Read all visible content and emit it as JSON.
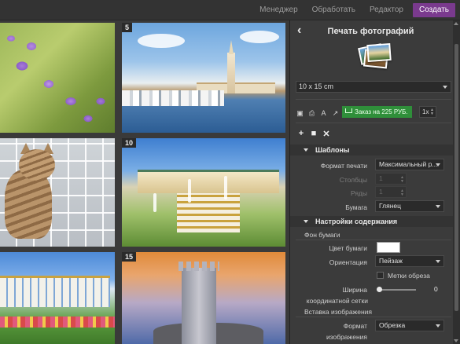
{
  "topnav": {
    "items": [
      "Менеджер",
      "Обработать",
      "Редактор"
    ],
    "create": "Создать"
  },
  "grid": {
    "numbers": [
      "5",
      "10",
      "15"
    ]
  },
  "panel": {
    "title": "Печать фотографий",
    "size": "10 x 15 cm",
    "order_label": "Заказ на 225 РУБ.",
    "quantity": "1x",
    "templates_header": "Шаблоны",
    "print_format_label": "Формат печати",
    "print_format_value": "Максимальный р...",
    "columns_label": "Столбцы",
    "columns_value": "1",
    "rows_label": "Ряды",
    "rows_value": "1",
    "paper_label": "Бумага",
    "paper_value": "Глянец",
    "content_header": "Настройки содержания",
    "paper_bg_group": "Фон бумаги",
    "paper_color_label": "Цвет бумаги",
    "paper_color": "#ffffff",
    "orientation_label": "Ориентация",
    "orientation_value": "Пейзаж",
    "crop_marks_label": "Метки обреза",
    "grid_width_label_1": "Ширина",
    "grid_width_label_2": "координатной сетки",
    "grid_width_value": "0",
    "insert_group": "Вставка изображения",
    "image_format_label_1": "Формат",
    "image_format_label_2": "изображения",
    "image_format_value": "Обрезка"
  },
  "colors": {
    "accent": "#7a3a8e",
    "order": "#2f8f3a"
  }
}
